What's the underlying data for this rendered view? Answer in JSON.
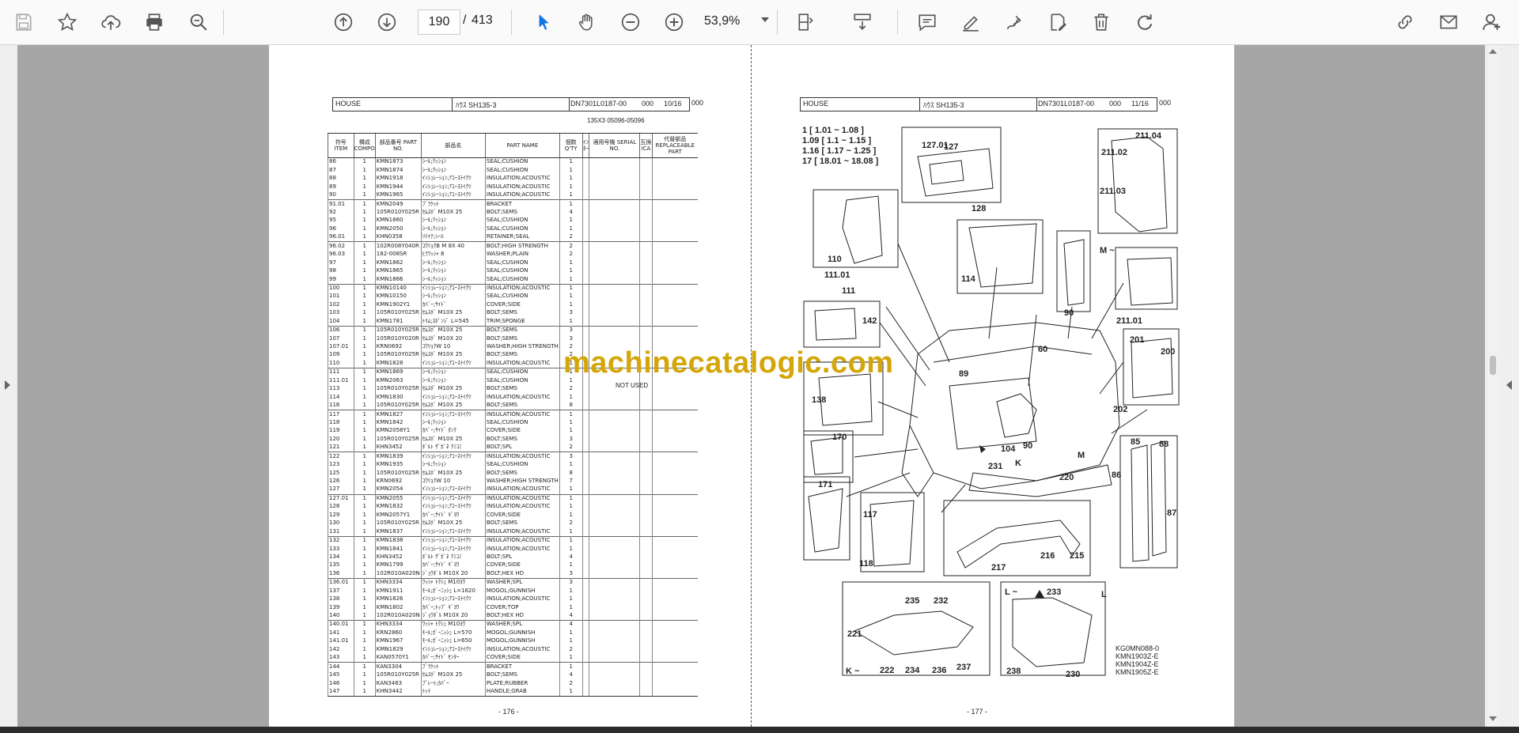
{
  "toolbar": {
    "left_icons": [
      "save-icon",
      "bookmark-star-icon",
      "upload-icon",
      "print-icon",
      "search-zoom-icon"
    ],
    "page_current": "190",
    "page_separator": "/",
    "page_total": "413",
    "zoom_value": "53,9%",
    "right_icons": [
      "select-cursor-icon",
      "hand-pan-icon",
      "zoom-out-icon",
      "zoom-in-icon",
      "fit-page-icon",
      "scroll-mode-icon",
      "comment-icon",
      "highlight-pen-icon",
      "sign-pen-icon",
      "edit-pdf-icon",
      "delete-icon",
      "rotate-icon",
      "share-link-icon",
      "mail-icon",
      "add-user-icon"
    ],
    "accent": "#1473e6"
  },
  "watermark": "machinecatalogic.com",
  "left_page": {
    "header": {
      "section": "HOUSE",
      "title": "ﾊｳｽ SH135-3",
      "code": "DN7301L0187-00",
      "rev": "000",
      "sheet": "10/16",
      "extra": "000"
    },
    "subtitle": "135X3 05096-05096",
    "columns": [
      "符号 ITEM",
      "構成 COMPO",
      "部品番号 PART NO.",
      "部品名",
      "PART NAME",
      "個数 Q'TY",
      "ｲﾝﾀｰ",
      "適用号機 SERIAL NO.",
      "互換 ICA",
      "代替部品 REPLACEABLE PART"
    ],
    "rows": [
      [
        "86",
        "1",
        "KMN1873",
        "ｼｰﾙ;ｸｯｼｮﾝ",
        "SEAL;CUSHION",
        "1"
      ],
      [
        "87",
        "1",
        "KMN1874",
        "ｼｰﾙ;ｸｯｼｮﾝ",
        "SEAL;CUSHION",
        "1"
      ],
      [
        "88",
        "1",
        "KMN1918",
        "ｲﾝｼｭﾚｰｼｮﾝ;ｱｺｰｽﾃｲｸﾂ",
        "INSULATION;ACOUSTIC",
        "1"
      ],
      [
        "89",
        "1",
        "KMN1944",
        "ｲﾝｼｭﾚｰｼｮﾝ;ｱｺｰｽﾃｲｸﾂ",
        "INSULATION;ACOUSTIC",
        "1"
      ],
      [
        "90",
        "1",
        "KMN1965",
        "ｲﾝｼｭﾚｰｼｮﾝ;ｱｺｰｽﾃｲｸﾂ",
        "INSULATION;ACOUSTIC",
        "1"
      ],
      [
        "91.01",
        "1",
        "KMN2049",
        "ﾌﾞﾗｹｯﾄ",
        "BRACKET",
        "1"
      ],
      [
        "92",
        "1",
        "105R010Y025R",
        "ｾﾑｽﾎﾞ M10X 25",
        "BOLT;SEMS",
        "4"
      ],
      [
        "95",
        "1",
        "KMN1860",
        "ｼｰﾙ;ｸｯｼｮﾝ",
        "SEAL;CUSHION",
        "1"
      ],
      [
        "96",
        "1",
        "KMN2050",
        "ｼｰﾙ;ｸｯｼｮﾝ",
        "SEAL;CUSHION",
        "1"
      ],
      [
        "96.01",
        "1",
        "KHN0358",
        "ﾘﾃｲﾅ;ｼｰﾙ",
        "RETAINER;SEAL",
        "2"
      ],
      [
        "96.02",
        "1",
        "102R008Y040R",
        "ｺｳﾘｮｸB M 8X 40",
        "BOLT;HIGH STRENGTH",
        "2"
      ],
      [
        "96.03",
        "1",
        "182-008SR",
        "ﾋﾗﾜｯｼｬ 8",
        "WASHER;PLAIN",
        "2"
      ],
      [
        "97",
        "1",
        "KMN1862",
        "ｼｰﾙ;ｸｯｼｮﾝ",
        "SEAL;CUSHION",
        "1"
      ],
      [
        "98",
        "1",
        "KMN1865",
        "ｼｰﾙ;ｸｯｼｮﾝ",
        "SEAL;CUSHION",
        "1"
      ],
      [
        "99",
        "1",
        "KMN1866",
        "ｼｰﾙ;ｸｯｼｮﾝ",
        "SEAL;CUSHION",
        "1"
      ],
      [
        "100",
        "1",
        "KMN10140",
        "ｲﾝｼｭﾚｰｼｮﾝ;ｱｺｰｽﾃｲｸﾂ",
        "INSULATION;ACOUSTIC",
        "1"
      ],
      [
        "101",
        "1",
        "KMN10150",
        "ｼｰﾙ;ｸｯｼｮﾝ",
        "SEAL;CUSHION",
        "1"
      ],
      [
        "102",
        "1",
        "KMN1902Y1",
        "ｶﾊﾞｰ;ｻｲﾄﾞ",
        "COVER;SIDE",
        "1"
      ],
      [
        "103",
        "1",
        "105R010Y025R",
        "ｾﾑｽﾎﾞ M10X 25",
        "BOLT;SEMS",
        "3"
      ],
      [
        "104",
        "1",
        "KMN1781",
        "ﾄﾘﾑ;ｽﾎﾟﾝｼﾞ L=545",
        "TRIM;SPONGE",
        "1"
      ],
      [
        "106",
        "1",
        "105R010Y025R",
        "ｾﾑｽﾎﾞ M10X 25",
        "BOLT;SEMS",
        "3"
      ],
      [
        "107",
        "1",
        "105R010Y020R",
        "ｾﾑｽﾎﾞ M10X 20",
        "BOLT;SEMS",
        "3"
      ],
      [
        "107.01",
        "1",
        "KRN0692",
        "ｺｳﾘｮｸW 10",
        "WASHER;HIGH STRENGTH",
        "2"
      ],
      [
        "109",
        "1",
        "105R010Y025R",
        "ｾﾑｽﾎﾞ M10X 25",
        "BOLT;SEMS",
        "2"
      ],
      [
        "110",
        "1",
        "KMN1828",
        "ｲﾝｼｭﾚｰｼｮﾝ;ｱｺｰｽﾃｲｸﾂ",
        "INSULATION;ACOUSTIC",
        "1"
      ],
      [
        "111",
        "1",
        "KMN1869",
        "ｼｰﾙ;ｸｯｼｮﾝ",
        "SEAL;CUSHION",
        "1"
      ],
      [
        "111.01",
        "1",
        "KMN2063",
        "ｼｰﾙ;ｸｯｼｮﾝ",
        "SEAL;CUSHION",
        "1"
      ],
      [
        "113",
        "1",
        "105R010Y025R",
        "ｾﾑｽﾎﾞ M10X 25",
        "BOLT;SEMS",
        "2"
      ],
      [
        "114",
        "1",
        "KMN1830",
        "ｲﾝｼｭﾚｰｼｮﾝ;ｱｺｰｽﾃｲｸﾂ",
        "INSULATION;ACOUSTIC",
        "1"
      ],
      [
        "116",
        "1",
        "105R010Y025R",
        "ｾﾑｽﾎﾞ M10X 25",
        "BOLT;SEMS",
        "8"
      ],
      [
        "117",
        "1",
        "KMN1827",
        "ｲﾝｼｭﾚｰｼｮﾝ;ｱｺｰｽﾃｲｸﾂ",
        "INSULATION;ACOUSTIC",
        "1"
      ],
      [
        "118",
        "1",
        "KMN1842",
        "ｼｰﾙ;ｸｯｼｮﾝ",
        "SEAL;CUSHION",
        "1"
      ],
      [
        "119",
        "1",
        "KMN2058Y1",
        "ｶﾊﾞｰ;ｻｲﾄﾞ ﾀﾝｸ",
        "COVER;SIDE",
        "1"
      ],
      [
        "120",
        "1",
        "105R010Y025R",
        "ｾﾑｽﾎﾞ M10X 25",
        "BOLT;SEMS",
        "3"
      ],
      [
        "121",
        "1",
        "KHN3452",
        "ﾎﾞﾙﾄ ｻﾞｶﾞﾈ ｸﾐｺﾐ",
        "BOLT;SPL",
        "2"
      ],
      [
        "122",
        "1",
        "KMN1839",
        "ｲﾝｼｭﾚｰｼｮﾝ;ｱｺｰｽﾃｲｸﾂ",
        "INSULATION;ACOUSTIC",
        "3"
      ],
      [
        "123",
        "1",
        "KMN1935",
        "ｼｰﾙ;ｸｯｼｮﾝ",
        "SEAL;CUSHION",
        "1"
      ],
      [
        "125",
        "1",
        "105R010Y025R",
        "ｾﾑｽﾎﾞ M10X 25",
        "BOLT;SEMS",
        "8"
      ],
      [
        "126",
        "1",
        "KRN0692",
        "ｺｳﾘｮｸW 10",
        "WASHER;HIGH STRENGTH",
        "7"
      ],
      [
        "127",
        "1",
        "KMN2054",
        "ｲﾝｼｭﾚｰｼｮﾝ;ｱｺｰｽﾃｲｸﾂ",
        "INSULATION;ACOUSTIC",
        "1"
      ],
      [
        "127.01",
        "1",
        "KMN2055",
        "ｲﾝｼｭﾚｰｼｮﾝ;ｱｺｰｽﾃｲｸﾂ",
        "INSULATION;ACOUSTIC",
        "1"
      ],
      [
        "128",
        "1",
        "KMN1832",
        "ｲﾝｼｭﾚｰｼｮﾝ;ｱｺｰｽﾃｲｸﾂ",
        "INSULATION;ACOUSTIC",
        "1"
      ],
      [
        "129",
        "1",
        "KMN2057Y1",
        "ｶﾊﾞｰ;ｻｲﾄﾞ ｷﾞﾖｳ",
        "COVER;SIDE",
        "1"
      ],
      [
        "130",
        "1",
        "105R010Y025R",
        "ｾﾑｽﾎﾞ M10X 25",
        "BOLT;SEMS",
        "2"
      ],
      [
        "131",
        "1",
        "KMN1837",
        "ｲﾝｼｭﾚｰｼｮﾝ;ｱｺｰｽﾃｲｸﾂ",
        "INSULATION;ACOUSTIC",
        "1"
      ],
      [
        "132",
        "1",
        "KMN1838",
        "ｲﾝｼｭﾚｰｼｮﾝ;ｱｺｰｽﾃｲｸﾂ",
        "INSULATION;ACOUSTIC",
        "1"
      ],
      [
        "133",
        "1",
        "KMN1841",
        "ｲﾝｼｭﾚｰｼｮﾝ;ｱｺｰｽﾃｲｸﾂ",
        "INSULATION;ACOUSTIC",
        "1"
      ],
      [
        "134",
        "1",
        "KHN3452",
        "ﾎﾞﾙﾄ ｻﾞｶﾞﾈ ｸﾐｺﾐ",
        "BOLT;SPL",
        "4"
      ],
      [
        "135",
        "1",
        "KMN1799",
        "ｶﾊﾞｰ;ｻｲﾄﾞ ｷﾞﾖｳ",
        "COVER;SIDE",
        "1"
      ],
      [
        "136",
        "1",
        "102R010A020N",
        "ｼﾞｮｳﾎﾞﾙ M10X 20",
        "BOLT;HEX HD",
        "3"
      ],
      [
        "136.01",
        "1",
        "KHN3334",
        "ﾜｯｼｬ ﾄｸｼｭ M10ﾖｳ",
        "WASHER;SPL",
        "3"
      ],
      [
        "137",
        "1",
        "KMN1911",
        "ﾓｰﾙ;ｶﾞｰﾆｯｼｭ L=1620",
        "MOGOL;GUNNISH",
        "1"
      ],
      [
        "138",
        "1",
        "KMN1826",
        "ｲﾝｼｭﾚｰｼｮﾝ;ｱｺｰｽﾃｲｸﾂ",
        "INSULATION;ACOUSTIC",
        "1"
      ],
      [
        "139",
        "1",
        "KMN1802",
        "ｶﾊﾞｰ;ﾄｯﾌﾟ ｷﾞﾖｳ",
        "COVER;TOP",
        "1"
      ],
      [
        "140",
        "1",
        "102R010A020N",
        "ｼﾞｮｳﾎﾞﾙ M10X 20",
        "BOLT;HEX HD",
        "4"
      ],
      [
        "140.01",
        "1",
        "KHN3334",
        "ﾜｯｼｬ ﾄｸｼｭ M10ﾖｳ",
        "WASHER;SPL",
        "4"
      ],
      [
        "141",
        "1",
        "KRN2860",
        "ﾓｰﾙ;ｶﾞｰﾆｯｼｭ L=570",
        "MOGOL;GUNNISH",
        "1"
      ],
      [
        "141.01",
        "1",
        "KMN1967",
        "ﾓｰﾙ;ｶﾞｰﾆｯｼｭ L=650",
        "MOGOL;GUNNISH",
        "1"
      ],
      [
        "142",
        "1",
        "KMN1829",
        "ｲﾝｼｭﾚｰｼｮﾝ;ｱｺｰｽﾃｲｸﾂ",
        "INSULATION;ACOUSTIC",
        "2"
      ],
      [
        "143",
        "1",
        "KAN0570Y1",
        "ｶﾊﾞｰ;ｻｲﾄﾞ ｾﾝﾀｰ",
        "COVER;SIDE",
        "1"
      ],
      [
        "144",
        "1",
        "KAN3304",
        "ﾌﾞﾗｹｯﾄ",
        "BRACKET",
        "1"
      ],
      [
        "145",
        "1",
        "105R010Y025R",
        "ｾﾑｽﾎﾞ M10X 25",
        "BOLT;SEMS",
        "4"
      ],
      [
        "146",
        "1",
        "KAN3463",
        "ﾌﾟﾚｰﾄ;ｶﾊﾞｰ",
        "PLATE;RUBBER",
        "2"
      ],
      [
        "147",
        "1",
        "KHN3442",
        "ﾄｯﾃ",
        "HANDLE;GRAB",
        "1"
      ]
    ],
    "note": "NOT USED",
    "page_number": "- 176 -"
  },
  "right_page": {
    "header": {
      "section": "HOUSE",
      "title": "ﾊｳｽ SH135-3",
      "code": "DN7301L0187-00",
      "rev": "000",
      "sheet": "11/16",
      "extra": "000"
    },
    "refs": [
      "1 [ 1.01 ~ 1.08 ]",
      "1.09 [ 1.1 ~ 1.15 ]",
      "1.16 [ 1.17 ~ 1.25 ]",
      "17 [ 18.01 ~ 18.08 ]"
    ],
    "callouts": [
      "127.01",
      "127",
      "128",
      "211.04",
      "211.02",
      "211.03",
      "M ~",
      "110",
      "111.01",
      "111",
      "114",
      "90",
      "211.01",
      "142",
      "60",
      "89",
      "201",
      "200",
      "138",
      "202",
      "170",
      "104",
      "90",
      "K",
      "231",
      "220",
      "M",
      "85",
      "88",
      "86",
      "87",
      "171",
      "117",
      "118",
      "217",
      "216",
      "215",
      "L",
      "235",
      "232",
      "L ~",
      "233",
      "221",
      "K ~",
      "222",
      "234",
      "236",
      "237",
      "238",
      "230"
    ],
    "part_codes": [
      "KG0MN088-0",
      "KMN1903Z-E",
      "KMN1904Z-E",
      "KMN1905Z-E"
    ],
    "page_number": "- 177 -"
  }
}
